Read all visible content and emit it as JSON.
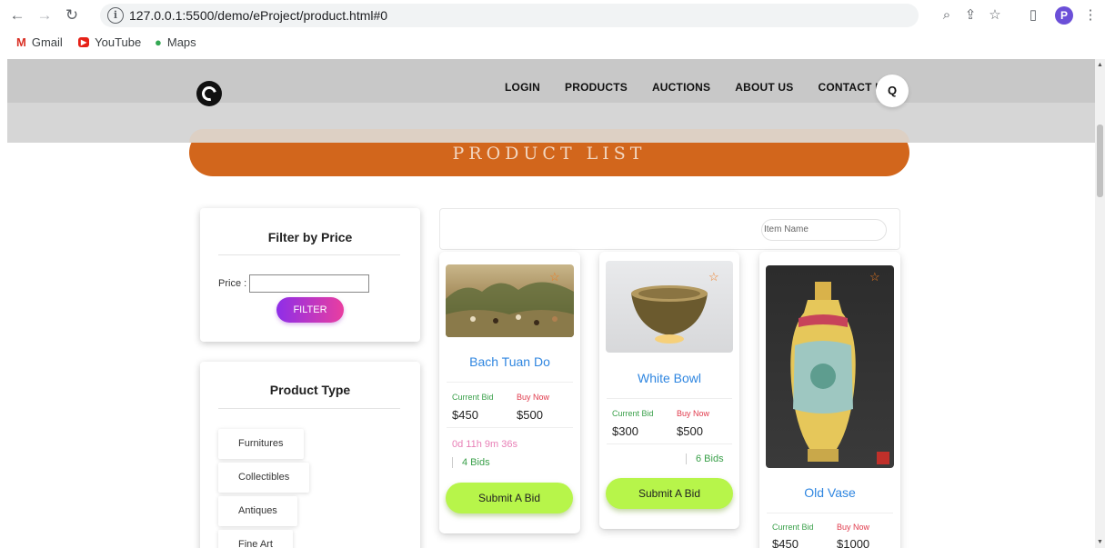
{
  "browser": {
    "url": "127.0.0.1:5500/demo/eProject/product.html#0",
    "profile_initial": "P",
    "bookmarks": [
      {
        "label": "Gmail",
        "icon": "gmail-icon"
      },
      {
        "label": "YouTube",
        "icon": "youtube-icon"
      },
      {
        "label": "Maps",
        "icon": "maps-icon"
      }
    ]
  },
  "header": {
    "nav": [
      "LOGIN",
      "PRODUCTS",
      "AUCTIONS",
      "ABOUT US",
      "CONTACT US"
    ],
    "search_icon": "search-icon"
  },
  "banner": {
    "title": "PRODUCT LIST"
  },
  "filter_price": {
    "title": "Filter by Price",
    "price_label": "Price :",
    "button": "FILTER"
  },
  "product_type": {
    "title": "Product Type",
    "items": [
      "Furnitures",
      "Collectibles",
      "Antiques",
      "Fine Art"
    ]
  },
  "search": {
    "placeholder": "Item Name"
  },
  "cards": [
    {
      "title": "Bach Tuan Do",
      "current_bid_label": "Current Bid",
      "buy_now_label": "Buy Now",
      "current_bid": "$450",
      "buy_now": "$500",
      "timer": "0d 11h 9m 36s",
      "bids": "4 Bids",
      "button": "Submit A Bid"
    },
    {
      "title": "White Bowl",
      "current_bid_label": "Current Bid",
      "buy_now_label": "Buy Now",
      "current_bid": "$300",
      "buy_now": "$500",
      "bids": "6 Bids",
      "button": "Submit A Bid"
    },
    {
      "title": "Old Vase",
      "current_bid_label": "Current Bid",
      "buy_now_label": "Buy Now",
      "current_bid": "$450",
      "buy_now": "$1000"
    }
  ],
  "colors": {
    "banner": "#d2661c",
    "filter_gradient_start": "#8e2ee8",
    "filter_gradient_end": "#e93ea0",
    "bid_button": "#b7f54a",
    "card_title": "#2f86e0"
  }
}
